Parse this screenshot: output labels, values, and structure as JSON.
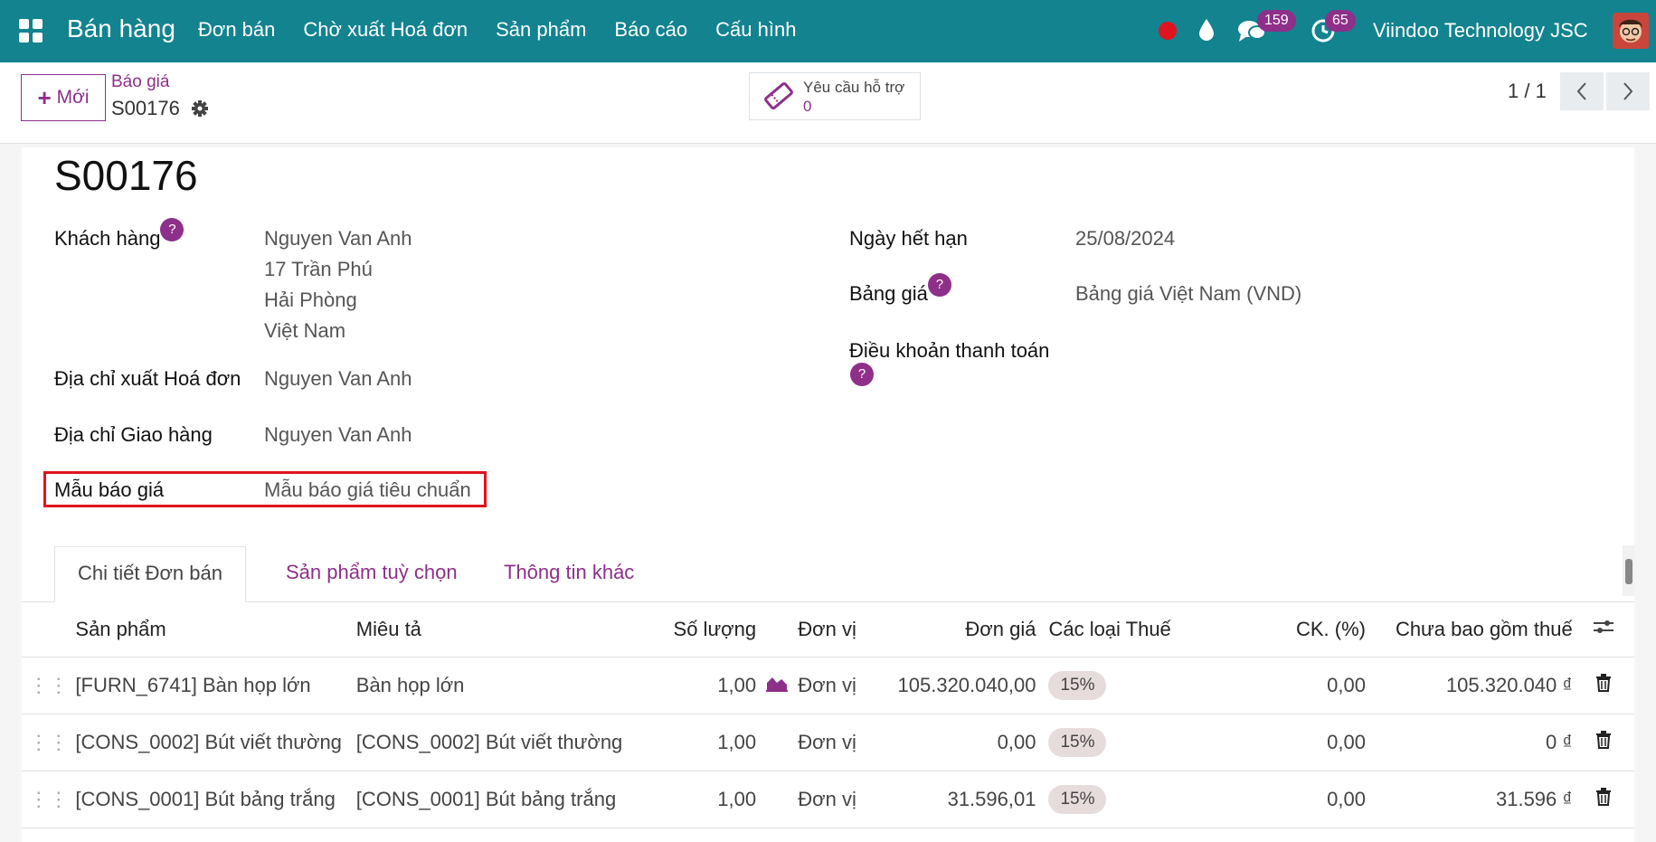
{
  "navbar": {
    "app_name": "Bán hàng",
    "menu": [
      "Đơn bán",
      "Chờ xuất Hoá đơn",
      "Sản phẩm",
      "Báo cáo",
      "Cấu hình"
    ],
    "messages_count": "159",
    "activities_count": "65",
    "company": "Viindoo Technology JSC"
  },
  "control_panel": {
    "new_label": "Mới",
    "breadcrumb": "Báo giá",
    "record_name": "S00176",
    "support_label": "Yêu cầu hỗ trợ",
    "support_count": "0",
    "pager": "1 / 1"
  },
  "form": {
    "title": "S00176",
    "customer_label": "Khách hàng",
    "customer_lines": [
      "Nguyen Van Anh",
      "17 Trần Phú",
      "Hải Phòng",
      "Việt Nam"
    ],
    "invoice_address_label": "Địa chỉ xuất Hoá đơn",
    "invoice_address": "Nguyen Van Anh",
    "delivery_address_label": "Địa chỉ Giao hàng",
    "delivery_address": "Nguyen Van Anh",
    "template_label": "Mẫu báo giá",
    "template_value": "Mẫu báo giá tiêu chuẩn",
    "expiry_label": "Ngày hết hạn",
    "expiry_value": "25/08/2024",
    "pricelist_label": "Bảng giá",
    "pricelist_value": "Bảng giá Việt Nam (VND)",
    "payment_terms_label": "Điều khoản thanh toán",
    "help_glyph": "?"
  },
  "tabs": [
    "Chi tiết Đơn bán",
    "Sản phẩm tuỳ chọn",
    "Thông tin khác"
  ],
  "order_lines": {
    "columns": [
      "Sản phẩm",
      "Miêu tả",
      "Số lượng",
      "Đơn vị",
      "Đơn giá",
      "Các loại Thuế",
      "CK. (%)",
      "Chưa bao gồm thuế"
    ],
    "rows": [
      {
        "product": "[FURN_6741] Bàn họp lớn",
        "description": "Bàn họp lớn",
        "qty": "1,00",
        "uom": "Đơn vị",
        "price": "105.320.040,00",
        "tax": "15%",
        "discount": "0,00",
        "subtotal": "105.320.040 ₫"
      },
      {
        "product": "[CONS_0002] Bút viết thường",
        "description": "[CONS_0002] Bút viết thường",
        "qty": "1,00",
        "uom": "Đơn vị",
        "price": "0,00",
        "tax": "15%",
        "discount": "0,00",
        "subtotal": "0 ₫"
      },
      {
        "product": "[CONS_0001] Bút bảng trắng",
        "description": "[CONS_0001] Bút bảng trắng",
        "qty": "1,00",
        "uom": "Đơn vị",
        "price": "31.596,01",
        "tax": "15%",
        "discount": "0,00",
        "subtotal": "31.596 ₫"
      }
    ]
  },
  "colors": {
    "navbar": "#12838f",
    "accent": "#8e2f8a",
    "highlight": "#e0141e"
  }
}
